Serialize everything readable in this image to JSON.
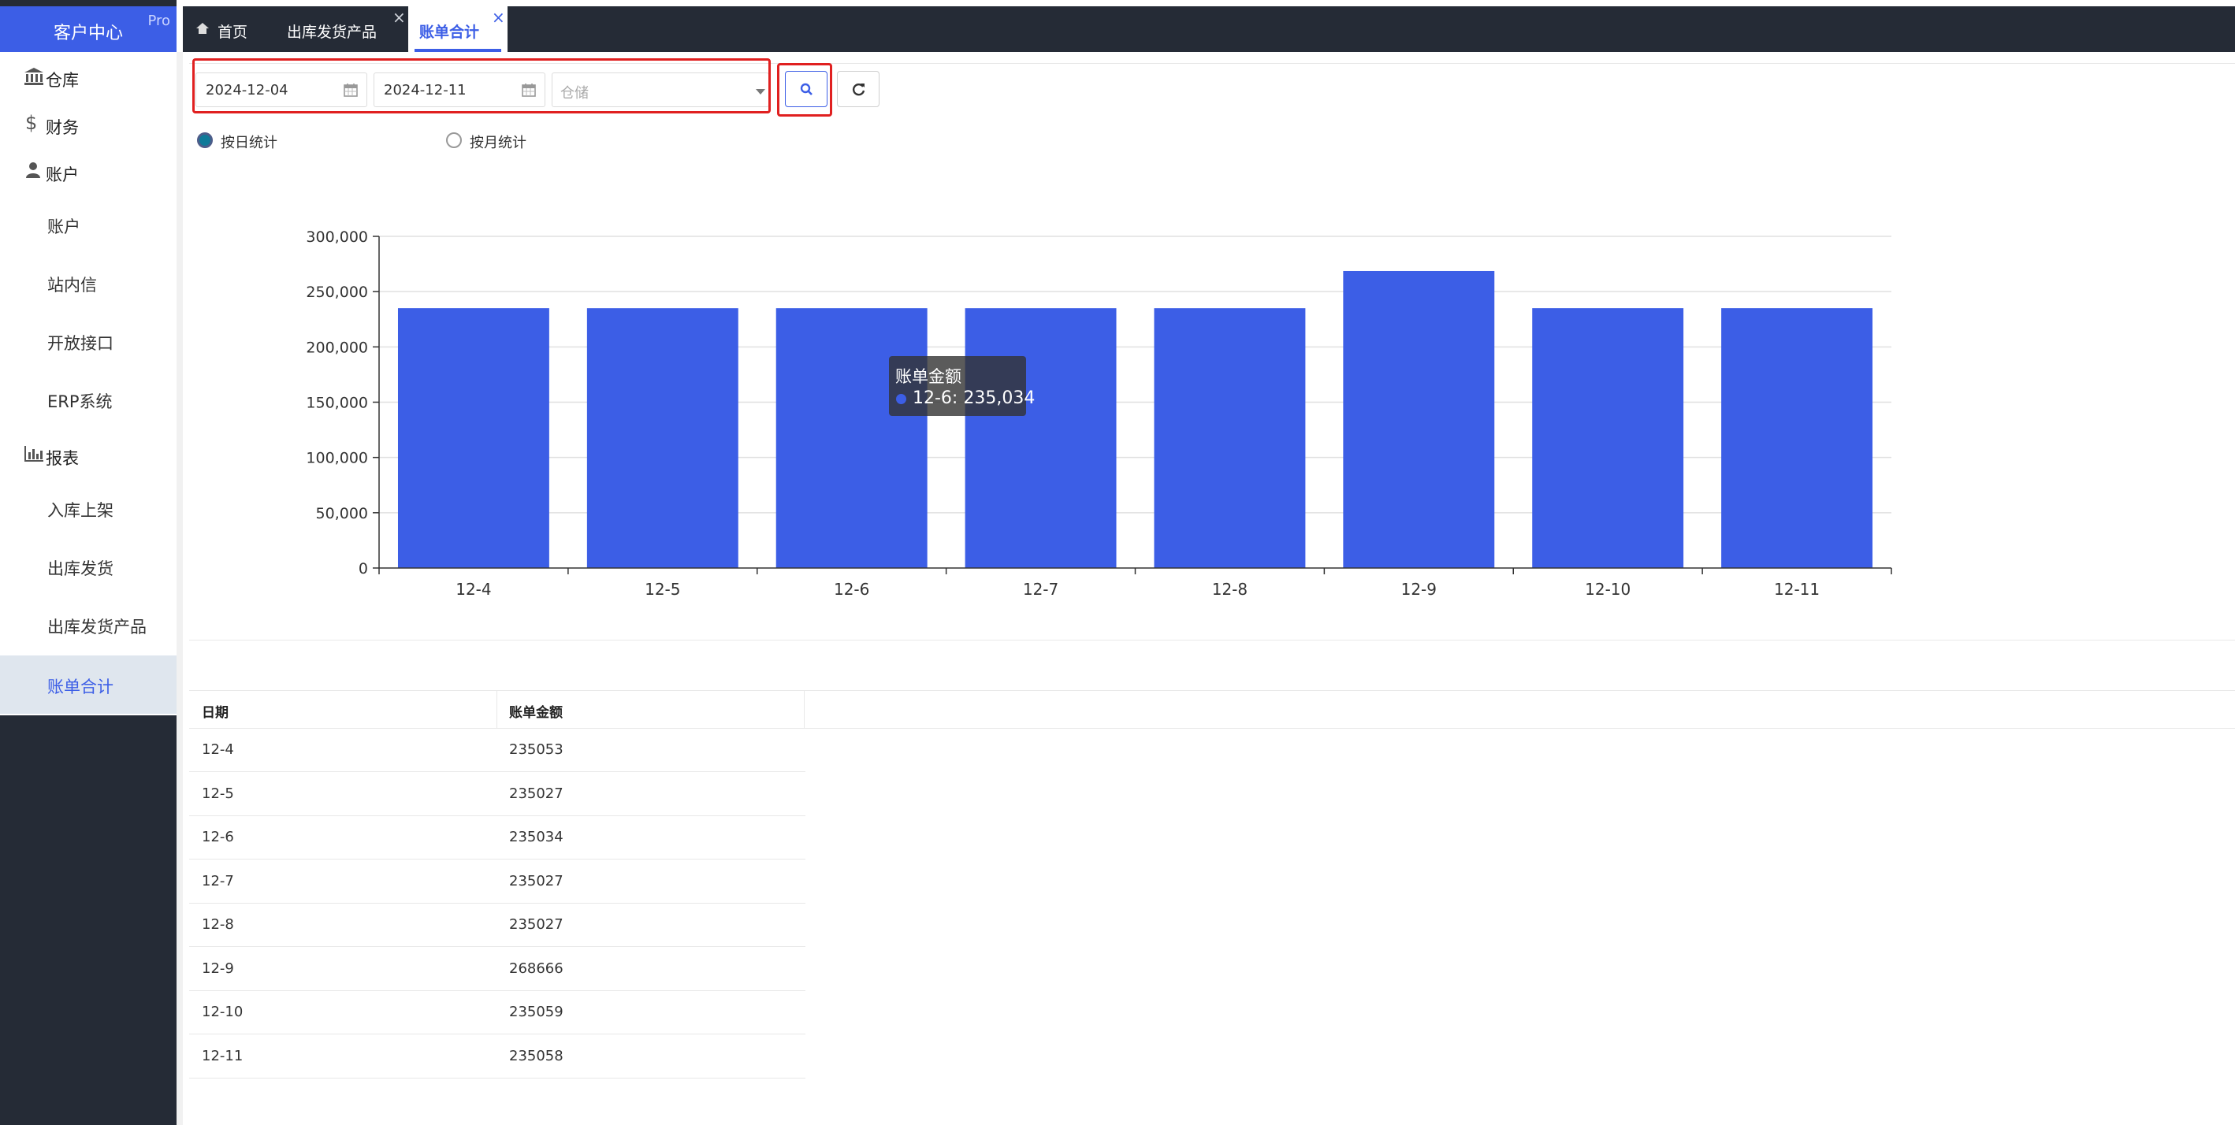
{
  "app": {
    "title": "客户中心",
    "badge": "Pro"
  },
  "sidebar": {
    "groups": [
      {
        "label": "仓库",
        "icon": "bank-icon"
      },
      {
        "label": "财务",
        "icon": "dollar-icon"
      },
      {
        "label": "账户",
        "icon": "user-icon"
      },
      {
        "label": "报表",
        "icon": "bar-chart-icon"
      }
    ],
    "account_items": [
      "账户",
      "站内信",
      "开放接口",
      "ERP系统"
    ],
    "report_items": [
      "入库上架",
      "出库发货",
      "出库发货产品",
      "账单合计"
    ],
    "active_item": "账单合计"
  },
  "tabs": [
    {
      "label": "首页",
      "icon": "home-icon"
    },
    {
      "label": "出库发货产品",
      "closable": true
    },
    {
      "label": "账单合计",
      "closable": true,
      "active": true
    }
  ],
  "filters": {
    "start_date": "2024-12-04",
    "end_date": "2024-12-11",
    "warehouse_placeholder": "仓储"
  },
  "stat_mode": {
    "options": [
      "按日统计",
      "按月统计"
    ],
    "selected": "按日统计"
  },
  "tooltip": {
    "title": "账单金额",
    "line": "12-6: 235,034"
  },
  "colors": {
    "brand": "#3c5ee6",
    "sidebar_dark": "#252b36",
    "highlight": "#e02020"
  },
  "chart_data": {
    "type": "bar",
    "categories": [
      "12-4",
      "12-5",
      "12-6",
      "12-7",
      "12-8",
      "12-9",
      "12-10",
      "12-11"
    ],
    "series": [
      {
        "name": "账单金额",
        "values": [
          235053,
          235027,
          235034,
          235027,
          235027,
          268666,
          235059,
          235058
        ]
      }
    ],
    "ylim": [
      0,
      300000
    ],
    "yticks": [
      "0",
      "50,000",
      "100,000",
      "150,000",
      "200,000",
      "250,000",
      "300,000"
    ],
    "grid": true,
    "bar_color": "#3c5ee6"
  },
  "table": {
    "headers": [
      "日期",
      "账单金额"
    ],
    "rows": [
      [
        "12-4",
        "235053"
      ],
      [
        "12-5",
        "235027"
      ],
      [
        "12-6",
        "235034"
      ],
      [
        "12-7",
        "235027"
      ],
      [
        "12-8",
        "235027"
      ],
      [
        "12-9",
        "268666"
      ],
      [
        "12-10",
        "235059"
      ],
      [
        "12-11",
        "235058"
      ]
    ]
  }
}
